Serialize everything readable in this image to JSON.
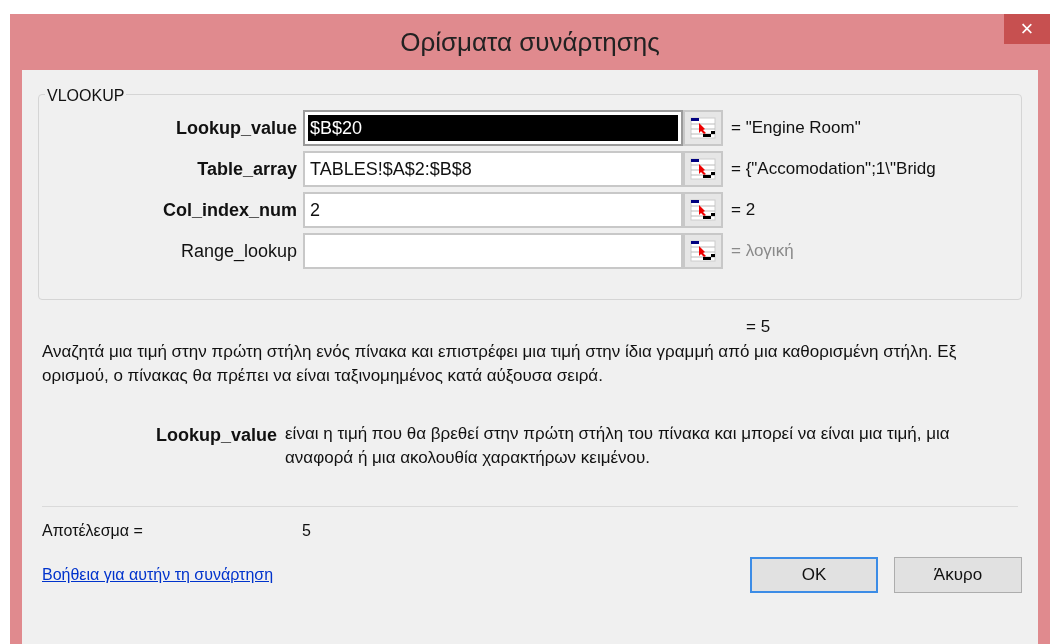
{
  "window": {
    "title": "Ορίσματα συνάρτησης",
    "close": "×"
  },
  "group": {
    "title": "VLOOKUP",
    "arguments": [
      {
        "label": "Lookup_value",
        "required": true,
        "value": "$B$20",
        "selected": true,
        "result": "= \"Engine Room\"",
        "dimmed": false
      },
      {
        "label": "Table_array",
        "required": true,
        "value": "TABLES!$A$2:$B$8",
        "selected": false,
        "result": "= {\"Accomodation\";1\\\"Bridg",
        "dimmed": false
      },
      {
        "label": "Col_index_num",
        "required": true,
        "value": "2",
        "selected": false,
        "result": "= 2",
        "dimmed": false
      },
      {
        "label": "Range_lookup",
        "required": false,
        "selected": false,
        "result": "= λογική",
        "dimmed": true
      }
    ]
  },
  "formula_result": "= 5",
  "description": "Αναζητά μια τιμή στην πρώτη στήλη ενός πίνακα και επιστρέφει μια τιμή στην ίδια γραμμή από μια καθορισμένη στήλη. Εξ ορισμού, ο πίνακας θα πρέπει να είναι ταξινομημένος κατά αύξουσα σειρά.",
  "argument_help": {
    "name": "Lookup_value",
    "text": "είναι η τιμή που θα βρεθεί στην πρώτη στήλη του πίνακα και μπορεί να είναι μια τιμή, μια αναφορά ή μια ακολουθία χαρακτήρων κειμένου."
  },
  "result": {
    "label": "Αποτέλεσμα =",
    "value": "5"
  },
  "help_link": "Βοήθεια για αυτήν τη συνάρτηση",
  "buttons": [
    {
      "label": "OK",
      "default": true
    },
    {
      "label": "Άκυρο",
      "default": false
    }
  ]
}
